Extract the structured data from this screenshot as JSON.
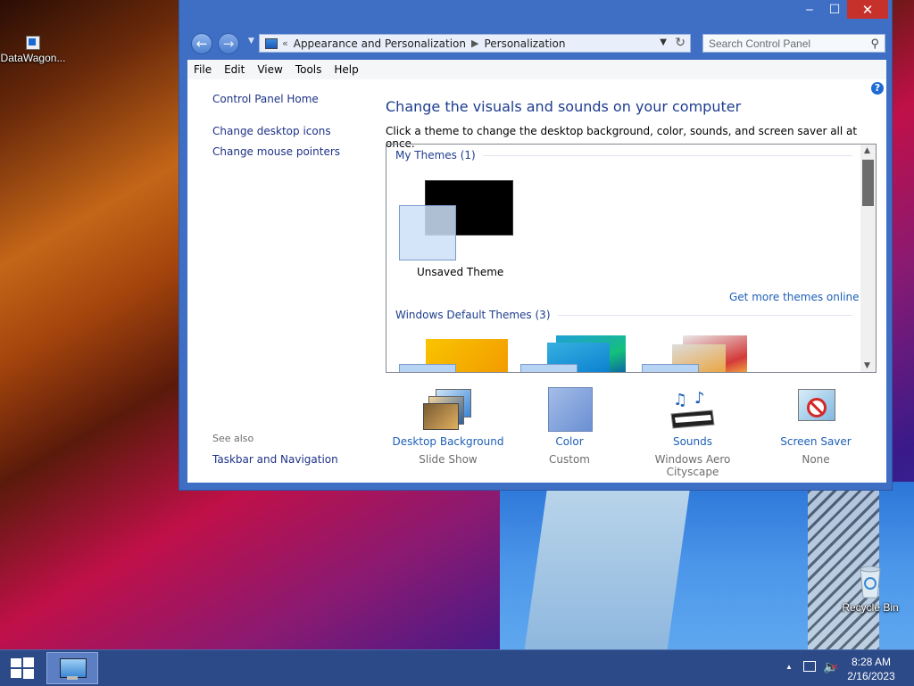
{
  "desktop": {
    "icons": [
      {
        "label": "DataWagon..."
      },
      {
        "label": "Recycle Bin"
      }
    ]
  },
  "window": {
    "controls": {
      "minimize": "‒",
      "maximize": "☐",
      "close": "✕"
    },
    "nav": {
      "back": "←",
      "forward": "→",
      "breadcrumb": [
        "Appearance and Personalization",
        "Personalization"
      ],
      "breadcrumb_prefix": "«",
      "search_placeholder": "Search Control Panel"
    },
    "menu": [
      "File",
      "Edit",
      "View",
      "Tools",
      "Help"
    ],
    "left_pane": {
      "home": "Control Panel Home",
      "links": [
        "Change desktop icons",
        "Change mouse pointers"
      ],
      "see_also_label": "See also",
      "see_also_links": [
        "Taskbar and Navigation"
      ]
    },
    "main": {
      "heading": "Change the visuals and sounds on your computer",
      "subtext": "Click a theme to change the desktop background, color, sounds, and screen saver all at once.",
      "my_themes_label": "My Themes (1)",
      "unsaved_theme_label": "Unsaved Theme",
      "get_more_link": "Get more themes online",
      "default_themes_label": "Windows Default Themes (3)",
      "help": "?"
    },
    "bottom": [
      {
        "label": "Desktop Background",
        "value": "Slide Show"
      },
      {
        "label": "Color",
        "value": "Custom"
      },
      {
        "label": "Sounds",
        "value": "Windows Aero Cityscape"
      },
      {
        "label": "Screen Saver",
        "value": "None"
      }
    ],
    "colors": {
      "accent": "#3f6fc5",
      "link": "#1e5fb7",
      "heading": "#1e3d8f",
      "close": "#c7312c"
    }
  },
  "taskbar": {
    "time": "8:28 AM",
    "date": "2/16/2023",
    "tray_chevron": "▲"
  }
}
